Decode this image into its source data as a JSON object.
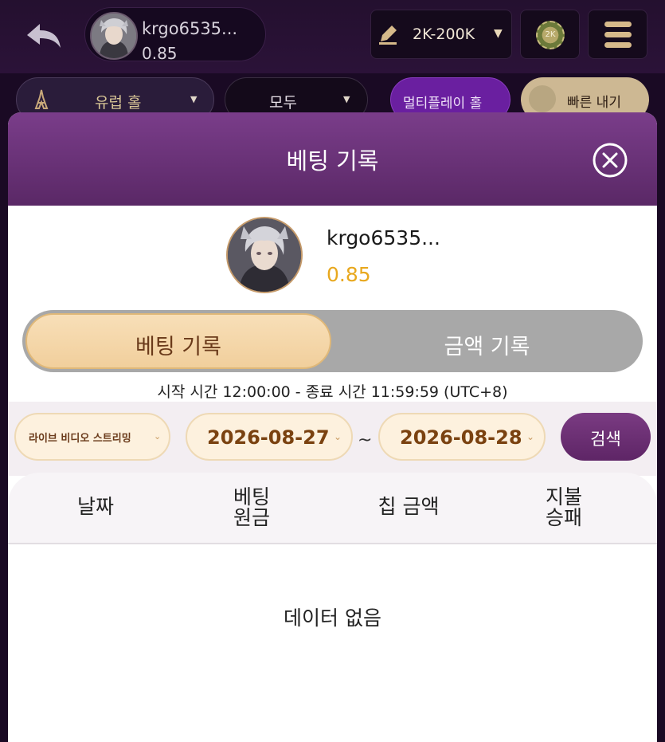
{
  "topbar": {
    "username": "krgo6535...",
    "balance": "0.85",
    "limit_label": "2K-200K",
    "chip_label": "2K"
  },
  "filters": {
    "hall_label": "유럽 홀",
    "all_label": "모두",
    "multiplay_label": "멀티플레이 홀",
    "fast_label": "빠른 내기"
  },
  "modal": {
    "title": "베팅 기록",
    "profile": {
      "username": "krgo6535...",
      "balance": "0.85"
    },
    "tabs": [
      {
        "label": "베팅 기록",
        "active": true
      },
      {
        "label": "금액 기록",
        "active": false
      }
    ],
    "time_range": "시작 시간 12:00:00 - 종료 시간 11:59:59 (UTC+8)",
    "stream_select": "라이브 비디오 스트리밍",
    "date_start": "2026-08-27",
    "date_separator": "~",
    "date_end": "2026-08-28",
    "search_label": "검색",
    "columns": {
      "date": "날짜",
      "bet_line1": "베팅",
      "bet_line2": "원금",
      "tip": "칩 금액",
      "result_line1": "지불",
      "result_line2": "승패"
    },
    "empty_text": "데이터 없음"
  },
  "colors": {
    "header_purple": "#6a3176",
    "tab_active": "#f4d5a6",
    "balance_gold": "#e8a81e",
    "search_button": "#6b2e74"
  }
}
